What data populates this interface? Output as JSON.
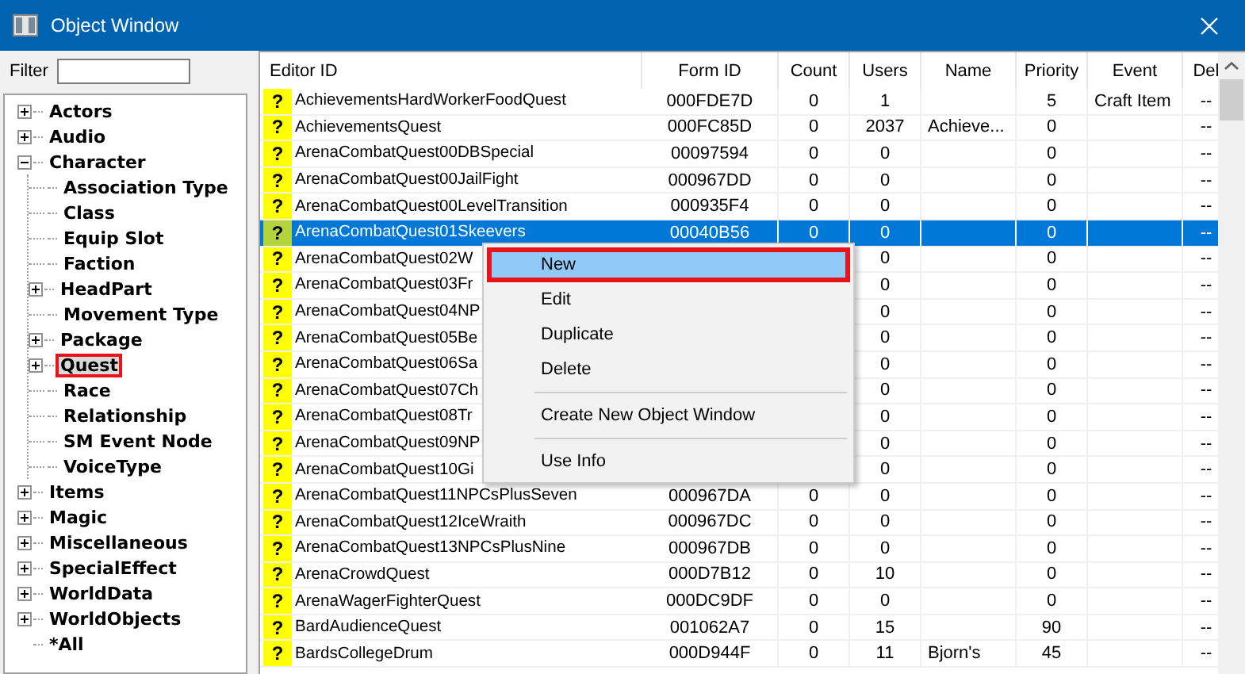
{
  "window": {
    "title": "Object Window"
  },
  "filter": {
    "label": "Filter"
  },
  "tree": {
    "items": [
      {
        "label": "Actors",
        "expanded": false,
        "selected": false,
        "annotated": false
      },
      {
        "label": "Audio",
        "expanded": false,
        "selected": false,
        "annotated": false
      },
      {
        "label": "Character",
        "expanded": true,
        "selected": false,
        "annotated": false,
        "children": [
          {
            "label": "Association Type",
            "selected": false,
            "annotated": false
          },
          {
            "label": "Class",
            "selected": false,
            "annotated": false
          },
          {
            "label": "Equip Slot",
            "selected": false,
            "annotated": false
          },
          {
            "label": "Faction",
            "selected": false,
            "annotated": false
          },
          {
            "label": "HeadPart",
            "expanded": false,
            "selected": false,
            "annotated": false
          },
          {
            "label": "Movement Type",
            "selected": false,
            "annotated": false
          },
          {
            "label": "Package",
            "expanded": false,
            "selected": false,
            "annotated": false
          },
          {
            "label": "Quest",
            "expanded": false,
            "selected": true,
            "annotated": true
          },
          {
            "label": "Race",
            "selected": false,
            "annotated": false
          },
          {
            "label": "Relationship",
            "selected": false,
            "annotated": false
          },
          {
            "label": "SM Event Node",
            "selected": false,
            "annotated": false
          },
          {
            "label": "VoiceType",
            "selected": false,
            "annotated": false
          }
        ]
      },
      {
        "label": "Items",
        "expanded": false,
        "selected": false,
        "annotated": false
      },
      {
        "label": "Magic",
        "expanded": false,
        "selected": false,
        "annotated": false
      },
      {
        "label": "Miscellaneous",
        "expanded": false,
        "selected": false,
        "annotated": false
      },
      {
        "label": "SpecialEffect",
        "expanded": false,
        "selected": false,
        "annotated": false
      },
      {
        "label": "WorldData",
        "expanded": false,
        "selected": false,
        "annotated": false
      },
      {
        "label": "WorldObjects",
        "expanded": false,
        "selected": false,
        "annotated": false
      },
      {
        "label": "*All",
        "selected": false,
        "annotated": false
      }
    ]
  },
  "table": {
    "columns": [
      "Editor ID",
      "Form ID",
      "Count",
      "Users",
      "Name",
      "Priority",
      "Event",
      "Del"
    ],
    "rows": [
      {
        "icon": "?",
        "editor_id": "AchievementsHardWorkerFoodQuest",
        "form_id": "000FDE7D",
        "count": "0",
        "users": "1",
        "priority": "5",
        "event": "Craft Item",
        "del": "--",
        "selected": false
      },
      {
        "icon": "?",
        "editor_id": "AchievementsQuest",
        "form_id": "000FC85D",
        "count": "0",
        "users": "2037",
        "name": "Achieve...",
        "priority": "0",
        "del": "--",
        "selected": false
      },
      {
        "icon": "?",
        "editor_id": "ArenaCombatQuest00DBSpecial",
        "form_id": "00097594",
        "count": "0",
        "users": "0",
        "priority": "0",
        "del": "--",
        "selected": false
      },
      {
        "icon": "?",
        "editor_id": "ArenaCombatQuest00JailFight",
        "form_id": "000967DD",
        "count": "0",
        "users": "0",
        "priority": "0",
        "del": "--",
        "selected": false
      },
      {
        "icon": "?",
        "editor_id": "ArenaCombatQuest00LevelTransition",
        "form_id": "000935F4",
        "count": "0",
        "users": "0",
        "priority": "0",
        "del": "--",
        "selected": false
      },
      {
        "icon": "?",
        "editor_id": "ArenaCombatQuest01Skeevers",
        "form_id": "00040B56",
        "count": "0",
        "users": "0",
        "priority": "0",
        "del": "--",
        "selected": true
      },
      {
        "icon": "?",
        "editor_id": "ArenaCombatQuest02W",
        "users": "0",
        "priority": "0",
        "del": "--",
        "selected": false
      },
      {
        "icon": "?",
        "editor_id": "ArenaCombatQuest03Fr",
        "users": "0",
        "priority": "0",
        "del": "--",
        "selected": false
      },
      {
        "icon": "?",
        "editor_id": "ArenaCombatQuest04NP",
        "users": "0",
        "priority": "0",
        "del": "--",
        "selected": false
      },
      {
        "icon": "?",
        "editor_id": "ArenaCombatQuest05Be",
        "users": "0",
        "priority": "0",
        "del": "--",
        "selected": false
      },
      {
        "icon": "?",
        "editor_id": "ArenaCombatQuest06Sa",
        "users": "0",
        "priority": "0",
        "del": "--",
        "selected": false
      },
      {
        "icon": "?",
        "editor_id": "ArenaCombatQuest07Ch",
        "users": "0",
        "priority": "0",
        "del": "--",
        "selected": false
      },
      {
        "icon": "?",
        "editor_id": "ArenaCombatQuest08Tr",
        "users": "0",
        "priority": "0",
        "del": "--",
        "selected": false
      },
      {
        "icon": "?",
        "editor_id": "ArenaCombatQuest09NP",
        "users": "0",
        "priority": "0",
        "del": "--",
        "selected": false
      },
      {
        "icon": "?",
        "editor_id": "ArenaCombatQuest10Gi",
        "users": "0",
        "priority": "0",
        "del": "--",
        "selected": false
      },
      {
        "icon": "?",
        "editor_id": "ArenaCombatQuest11NPCsPlusSeven",
        "form_id": "000967DA",
        "count": "0",
        "users": "0",
        "priority": "0",
        "del": "--",
        "selected": false
      },
      {
        "icon": "?",
        "editor_id": "ArenaCombatQuest12IceWraith",
        "form_id": "000967DC",
        "count": "0",
        "users": "0",
        "priority": "0",
        "del": "--",
        "selected": false
      },
      {
        "icon": "?",
        "editor_id": "ArenaCombatQuest13NPCsPlusNine",
        "form_id": "000967DB",
        "count": "0",
        "users": "0",
        "priority": "0",
        "del": "--",
        "selected": false
      },
      {
        "icon": "?",
        "editor_id": "ArenaCrowdQuest",
        "form_id": "000D7B12",
        "count": "0",
        "users": "10",
        "priority": "0",
        "del": "--",
        "selected": false
      },
      {
        "icon": "?",
        "editor_id": "ArenaWagerFighterQuest",
        "form_id": "000DC9DF",
        "count": "0",
        "users": "0",
        "priority": "0",
        "del": "--",
        "selected": false
      },
      {
        "icon": "?",
        "editor_id": "BardAudienceQuest",
        "form_id": "001062A7",
        "count": "0",
        "users": "15",
        "priority": "90",
        "del": "--",
        "selected": false
      },
      {
        "icon": "?",
        "editor_id": "BardsCollegeDrum",
        "form_id": "000D944F",
        "count": "0",
        "users": "11",
        "name": "Bjorn's",
        "priority": "45",
        "del": "--",
        "selected": false
      }
    ]
  },
  "context_menu": {
    "items": [
      {
        "kind": "item",
        "label": "New",
        "highlighted": true,
        "annotated": true
      },
      {
        "kind": "item",
        "label": "Edit",
        "highlighted": false,
        "annotated": false
      },
      {
        "kind": "item",
        "label": "Duplicate",
        "highlighted": false,
        "annotated": false
      },
      {
        "kind": "item",
        "label": "Delete",
        "highlighted": false,
        "annotated": false
      },
      {
        "kind": "separator"
      },
      {
        "kind": "item",
        "label": "Create New Object Window",
        "highlighted": false,
        "annotated": false
      },
      {
        "kind": "separator"
      },
      {
        "kind": "item",
        "label": "Use Info",
        "highlighted": false,
        "annotated": false
      }
    ]
  }
}
